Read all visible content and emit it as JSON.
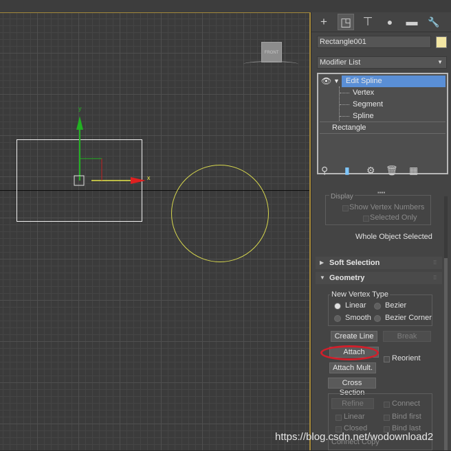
{
  "viewport": {
    "axis_x_label": "x",
    "axis_y_label": "y",
    "viewcube_label": "FRONT",
    "colors": {
      "rectangle": "#f2f2f2",
      "circle": "#d8d84e",
      "x_axis": "#e02020",
      "y_axis": "#22b022",
      "frame": "#a5893b"
    }
  },
  "command_panel": {
    "tabs": [
      {
        "icon": "plus-icon",
        "glyph": "+"
      },
      {
        "icon": "modify-icon",
        "glyph": "◳"
      },
      {
        "icon": "hierarchy-icon",
        "glyph": "⊤"
      },
      {
        "icon": "motion-icon",
        "glyph": "●"
      },
      {
        "icon": "display-icon",
        "glyph": "▬"
      },
      {
        "icon": "utilities-icon",
        "glyph": "🔧"
      }
    ],
    "object_name": "Rectangle001",
    "object_color": "#f2e6a3",
    "modifier_list_label": "Modifier List",
    "stack": {
      "edit_spline": "Edit Spline",
      "vertex": "Vertex",
      "segment": "Segment",
      "spline": "Spline",
      "rectangle": "Rectangle"
    },
    "display_group": {
      "title": "Display",
      "show_vertex_numbers": "Show Vertex Numbers",
      "selected_only": "Selected Only"
    },
    "selection_status": "Whole Object Selected",
    "soft_selection_title": "Soft Selection",
    "geometry_title": "Geometry",
    "new_vertex_type": {
      "title": "New Vertex Type",
      "linear": "Linear",
      "bezier": "Bezier",
      "smooth": "Smooth",
      "bezier_corner": "Bezier Corner",
      "selected": "Linear"
    },
    "buttons": {
      "create_line": "Create Line",
      "break": "Break",
      "attach": "Attach",
      "reorient": "Reorient",
      "attach_mult": "Attach Mult.",
      "cross_section": "Cross Section",
      "refine": "Refine",
      "connect": "Connect",
      "linear": "Linear",
      "bind_first": "Bind first",
      "closed": "Closed",
      "bind_last": "Bind last",
      "connect_copy": "Connect Copy"
    }
  },
  "watermark": "https://blog.csdn.net/wodownload2"
}
